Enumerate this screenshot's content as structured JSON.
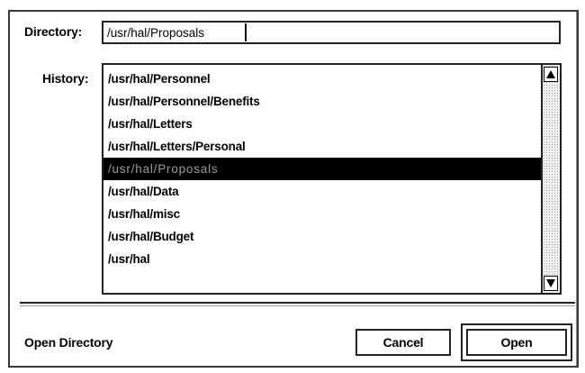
{
  "directory": {
    "label": "Directory:",
    "value": "/usr/hal/Proposals"
  },
  "history": {
    "label": "History:",
    "items": [
      "/usr/hal/Personnel",
      "/usr/hal/Personnel/Benefits",
      "/usr/hal/Letters",
      "/usr/hal/Letters/Personal",
      "/usr/hal/Proposals",
      "/usr/hal/Data",
      "/usr/hal/misc",
      "/usr/hal/Budget",
      "/usr/hal"
    ],
    "selected_index": 4
  },
  "scrollbar": {
    "up_icon": "arrow-up-icon",
    "down_icon": "arrow-down-icon"
  },
  "footer": {
    "status": "Open Directory",
    "cancel_label": "Cancel",
    "open_label": "Open"
  }
}
